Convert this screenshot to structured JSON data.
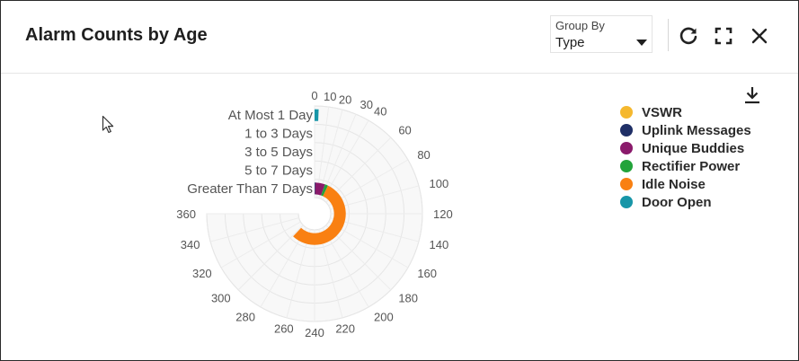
{
  "header": {
    "title": "Alarm Counts by Age",
    "group_by": {
      "label": "Group By",
      "value": "Type"
    },
    "icons": [
      "refresh-icon",
      "fullscreen-icon",
      "close-icon"
    ]
  },
  "chart_data": {
    "type": "stacked-radial-bar",
    "title": "Alarm Counts by Age",
    "categories": [
      "At Most 1 Day",
      "1 to 3 Days",
      "3 to 5 Days",
      "5 to 7 Days",
      "Greater Than 7 Days"
    ],
    "angle_axis": {
      "range": [
        0,
        360
      ],
      "ticks": [
        0,
        10,
        20,
        30,
        40,
        60,
        80,
        100,
        120,
        140,
        160,
        180,
        200,
        220,
        240,
        260,
        280,
        300,
        320,
        340,
        360
      ]
    },
    "series": [
      {
        "name": "VSWR",
        "color": "#f5b82e",
        "values": [
          0,
          0,
          0,
          0,
          0
        ]
      },
      {
        "name": "Uplink Messages",
        "color": "#1f2f66",
        "values": [
          0,
          0,
          0,
          0,
          2
        ]
      },
      {
        "name": "Unique Buddies",
        "color": "#8a1a6b",
        "values": [
          0,
          0,
          0,
          0,
          24
        ]
      },
      {
        "name": "Rectifier Power",
        "color": "#22a33a",
        "values": [
          0,
          0,
          0,
          0,
          8
        ]
      },
      {
        "name": "Idle Noise",
        "color": "#f98012",
        "values": [
          0,
          0,
          0,
          0,
          264
        ]
      },
      {
        "name": "Door Open",
        "color": "#1896a8",
        "values": [
          3,
          0,
          0,
          0,
          0
        ]
      }
    ],
    "legend_position": "right",
    "grid": true
  }
}
